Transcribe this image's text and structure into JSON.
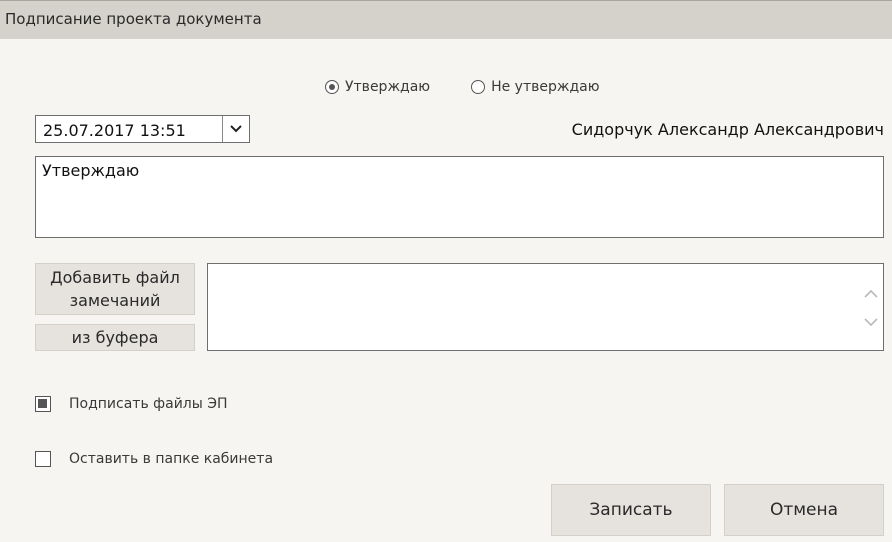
{
  "dialog": {
    "title": "Подписание проекта документа"
  },
  "decision": {
    "options": [
      {
        "label": "Утверждаю",
        "selected": true
      },
      {
        "label": "Не утверждаю",
        "selected": false
      }
    ]
  },
  "date_select": {
    "value": "25.07.2017 13:51",
    "icon": "chevron-down-icon"
  },
  "signer": {
    "name": "Сидорчук Александр Александрович"
  },
  "comment": {
    "value": "Утверждаю"
  },
  "attachments": {
    "add_file_label": "Добавить файл замечаний",
    "from_buffer_label": "из буфера"
  },
  "options": {
    "sign_files_label": "Подписать файлы ЭП",
    "sign_files_checked": true,
    "keep_in_folder_label": "Оставить в папке кабинета",
    "keep_in_folder_checked": false
  },
  "actions": {
    "save_label": "Записать",
    "cancel_label": "Отмена"
  },
  "colors": {
    "titlebar": "#d5d1cb",
    "background": "#f7f5f1",
    "button": "#e6e3de"
  }
}
